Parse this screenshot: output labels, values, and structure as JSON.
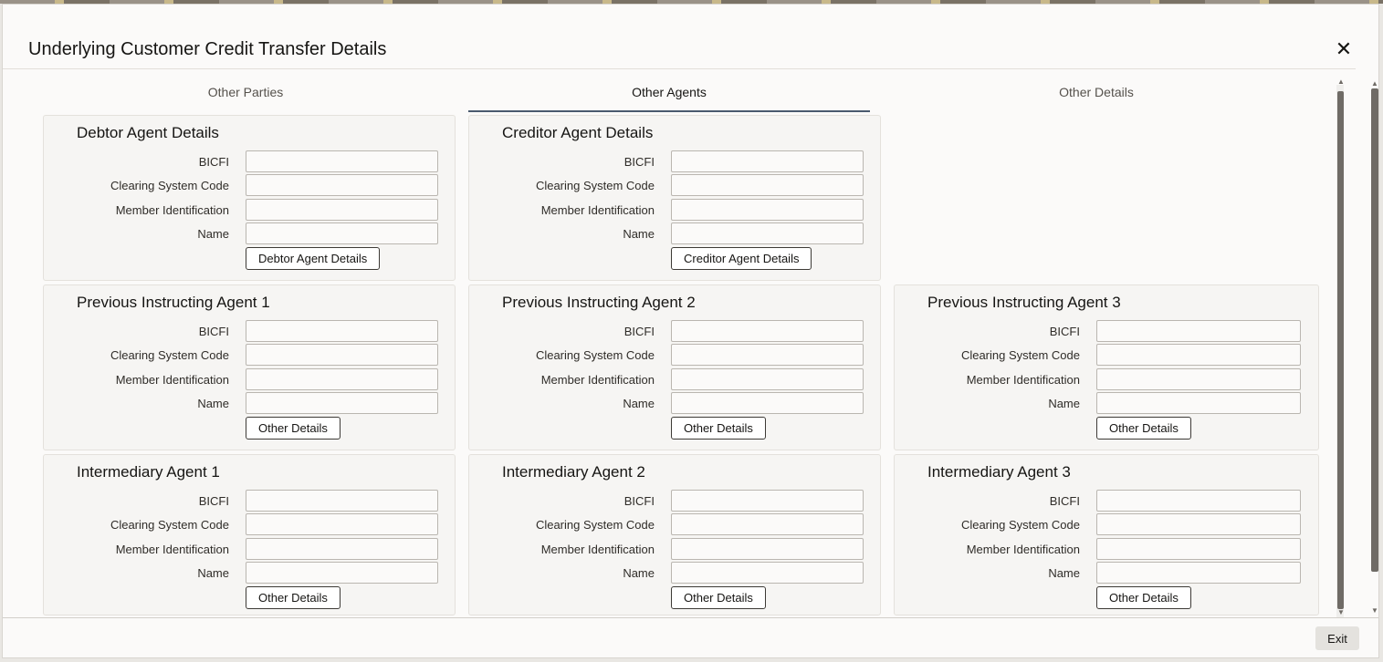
{
  "dialog": {
    "title": "Underlying Customer Credit Transfer Details",
    "close_icon": "close-icon"
  },
  "tabs": [
    {
      "label": "Other Parties",
      "active": false
    },
    {
      "label": "Other Agents",
      "active": true
    },
    {
      "label": "Other Details",
      "active": false
    }
  ],
  "fields": {
    "bicfi": "BICFI",
    "clearing": "Clearing System Code",
    "member": "Member Identification",
    "name": "Name"
  },
  "panels": {
    "debtor": {
      "title": "Debtor Agent Details",
      "button": "Debtor Agent Details"
    },
    "creditor": {
      "title": "Creditor Agent Details",
      "button": "Creditor Agent Details"
    },
    "prev1": {
      "title": "Previous Instructing Agent 1",
      "button": "Other Details"
    },
    "prev2": {
      "title": "Previous Instructing Agent 2",
      "button": "Other Details"
    },
    "prev3": {
      "title": "Previous Instructing Agent 3",
      "button": "Other Details"
    },
    "inter1": {
      "title": "Intermediary Agent 1",
      "button": "Other Details"
    },
    "inter2": {
      "title": "Intermediary Agent 2",
      "button": "Other Details"
    },
    "inter3": {
      "title": "Intermediary Agent 3",
      "button": "Other Details"
    }
  },
  "footer": {
    "exit_label": "Exit"
  }
}
